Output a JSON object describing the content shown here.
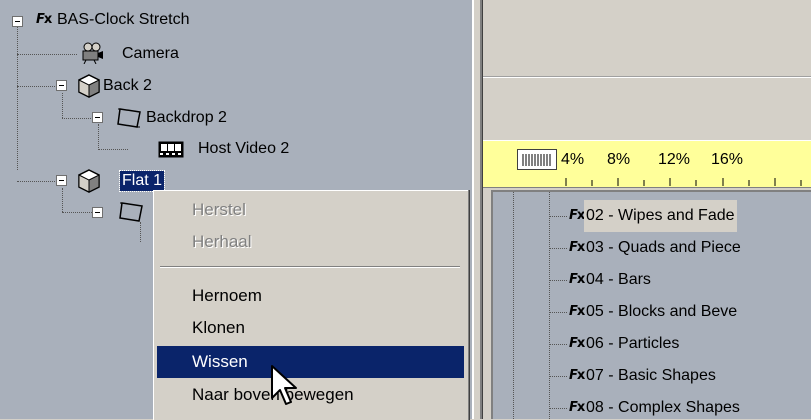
{
  "tree": {
    "root": {
      "label": "BAS-Clock Stretch",
      "icon": "fx-icon"
    },
    "camera": {
      "label": "Camera",
      "icon": "camera-icon"
    },
    "back": {
      "label": "Back 2",
      "icon": "cube-icon"
    },
    "backdrop": {
      "label": "Backdrop 2",
      "icon": "frame-icon"
    },
    "host_video": {
      "label": "Host Video 2",
      "icon": "film-icon"
    },
    "flat": {
      "label": "Flat 1",
      "icon": "cube-icon",
      "selected": true
    }
  },
  "context_menu": {
    "items": [
      {
        "label": "Herstel",
        "enabled": false
      },
      {
        "label": "Herhaal",
        "enabled": false
      },
      {
        "label": "Hernoem",
        "enabled": true
      },
      {
        "label": "Klonen",
        "enabled": true
      },
      {
        "label": "Wissen",
        "enabled": true,
        "highlighted": true
      },
      {
        "label": "Naar boven bewegen",
        "enabled": true
      }
    ]
  },
  "timeline": {
    "ticks": [
      "4%",
      "8%",
      "12%",
      "16%"
    ]
  },
  "effects": {
    "items": [
      "02 - Wipes and Fade",
      "03 - Quads and Piece",
      "04 - Bars",
      "05 - Blocks and Beve",
      "06 - Particles",
      "07 - Basic Shapes",
      "08 - Complex Shapes"
    ]
  },
  "colors": {
    "selection": "#0a246a",
    "tree_background": "#a9b0bb",
    "timeline_background": "#ffff9a"
  }
}
